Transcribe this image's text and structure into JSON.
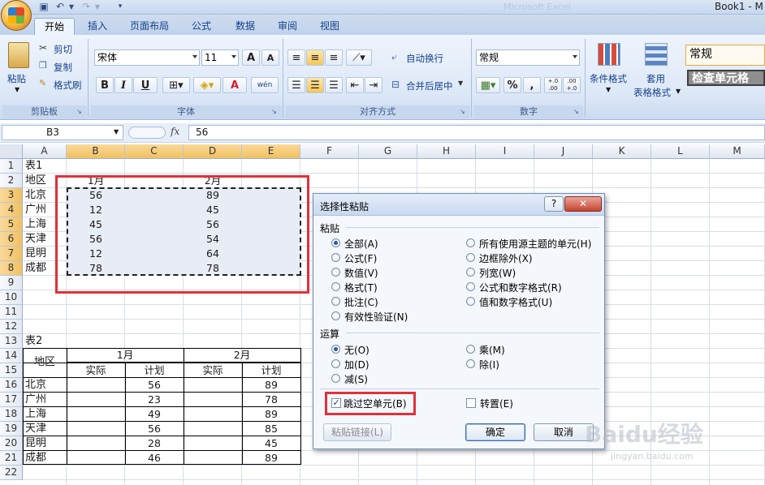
{
  "window": {
    "title": "Book1 - M",
    "ghost_title": "Microsoft Excel"
  },
  "tabs": [
    "开始",
    "插入",
    "页面布局",
    "公式",
    "数据",
    "审阅",
    "视图"
  ],
  "ribbon": {
    "clipboard": {
      "paste": "粘贴",
      "cut": "剪切",
      "copy": "复制",
      "format_painter": "格式刷",
      "label": "剪贴板"
    },
    "font": {
      "name": "宋体",
      "size": "11",
      "label": "字体",
      "bold": "B",
      "italic": "I",
      "underline": "U",
      "grow": "A",
      "shrink": "A",
      "color_a": "A",
      "phonetic": "wén"
    },
    "alignment": {
      "wrap": "自动换行",
      "merge": "合并后居中",
      "label": "对齐方式"
    },
    "number": {
      "format": "常规",
      "percent": "%",
      "comma": ",",
      "inc_dec": "+.0 .00",
      "dec_dec": ".00 +.0",
      "label": "数字"
    },
    "styles": {
      "conditional": "条件格式",
      "table_format_1": "套用",
      "table_format_2": "表格格式",
      "style_normal": "常规",
      "style_check": "检查单元格"
    }
  },
  "formula_bar": {
    "cell_ref": "B3",
    "fx": "fx",
    "value": "56"
  },
  "columns": [
    "A",
    "B",
    "C",
    "D",
    "E",
    "F",
    "G",
    "H",
    "I",
    "J",
    "K",
    "L",
    "M"
  ],
  "rows": [
    "1",
    "2",
    "3",
    "4",
    "5",
    "6",
    "7",
    "8",
    "9",
    "10",
    "11",
    "12",
    "13",
    "14",
    "15",
    "16",
    "17",
    "18",
    "19",
    "20",
    "21",
    "22"
  ],
  "table1": {
    "title": "表1",
    "header_region": "地区",
    "month1": "1月",
    "month2": "2月",
    "regions": [
      "北京",
      "广州",
      "上海",
      "天津",
      "昆明",
      "成都"
    ],
    "b_values": [
      "56",
      "12",
      "45",
      "56",
      "12",
      "78"
    ],
    "d_values": [
      "89",
      "45",
      "56",
      "54",
      "64",
      "78"
    ]
  },
  "table2": {
    "title": "表2",
    "header_region": "地区",
    "month1": "1月",
    "month2": "2月",
    "actual": "实际",
    "plan": "计划",
    "regions": [
      "北京",
      "广州",
      "上海",
      "天津",
      "昆明",
      "成都"
    ],
    "plan1": [
      "56",
      "23",
      "49",
      "56",
      "28",
      "46"
    ],
    "plan2": [
      "89",
      "78",
      "89",
      "85",
      "45",
      "89"
    ]
  },
  "dialog": {
    "title": "选择性粘贴",
    "help": "?",
    "close": "✕",
    "paste_section": "粘贴",
    "paste_left": [
      "全部(A)",
      "公式(F)",
      "数值(V)",
      "格式(T)",
      "批注(C)",
      "有效性验证(N)"
    ],
    "paste_right": [
      "所有使用源主题的单元(H)",
      "边框除外(X)",
      "列宽(W)",
      "公式和数字格式(R)",
      "值和数字格式(U)"
    ],
    "operation_section": "运算",
    "op_left": [
      "无(O)",
      "加(D)",
      "减(S)"
    ],
    "op_right": [
      "乘(M)",
      "除(I)"
    ],
    "skip_blanks": "跳过空单元(B)",
    "transpose": "转置(E)",
    "paste_link": "粘贴链接(L)",
    "ok": "确定",
    "cancel": "取消"
  },
  "watermark": {
    "text": "Baidu经验",
    "url": "jingyan.baidu.com"
  },
  "colors": {
    "accent": "#15428b",
    "highlight": "#e0313a",
    "selection": "#e8ecf5"
  }
}
